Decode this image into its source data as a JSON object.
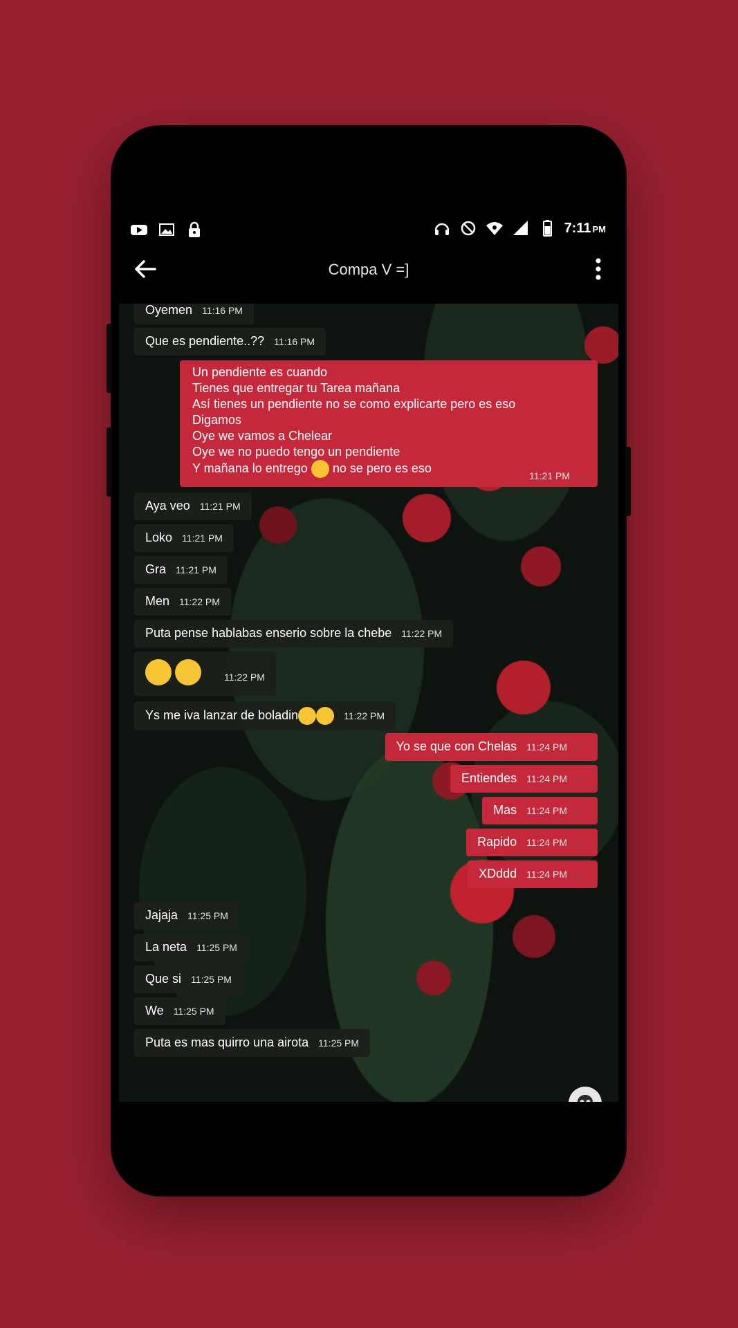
{
  "chat": {
    "title": "Compa V =]",
    "status_time": "7:11",
    "status_ampm": "PM",
    "messages": [
      {
        "dir": "in",
        "text": "Oyemen",
        "time": "11:16 PM"
      },
      {
        "dir": "in",
        "text": "Que es pendiente..??",
        "time": "11:16 PM"
      },
      {
        "dir": "out",
        "lines": [
          "Un pendiente es cuando",
          "Tienes que entregar tu Tarea mañana",
          "Así tienes un pendiente no se como explicarte pero es eso",
          "Digamos",
          "Oye we vamos a Chelear",
          "Oye we  no puedo tengo un pendiente",
          "Y mañana lo entrego",
          "no se pero es eso"
        ],
        "time": "11:21 PM"
      },
      {
        "dir": "in",
        "text": "Aya veo",
        "time": "11:21 PM"
      },
      {
        "dir": "in",
        "text": "Loko",
        "time": "11:21 PM"
      },
      {
        "dir": "in",
        "text": "Gra",
        "time": "11:21 PM"
      },
      {
        "dir": "in",
        "text": "Men",
        "time": "11:22 PM"
      },
      {
        "dir": "in",
        "text": "Puta pense hablabas enserio sobre la chebe",
        "time": "11:22 PM"
      },
      {
        "dir": "in",
        "text": "",
        "time": "11:22 PM"
      },
      {
        "dir": "in",
        "text": "Ys me iva lanzar de boladin",
        "time": "11:22 PM"
      },
      {
        "dir": "out",
        "text": "Yo se que con Chelas",
        "time": "11:24 PM"
      },
      {
        "dir": "out",
        "text": "Entiendes",
        "time": "11:24 PM"
      },
      {
        "dir": "out",
        "text": "Mas",
        "time": "11:24 PM"
      },
      {
        "dir": "out",
        "text": "Rapido",
        "time": "11:24 PM"
      },
      {
        "dir": "out",
        "text": "XDddd",
        "time": "11:24 PM"
      },
      {
        "dir": "in",
        "text": "Jajaja",
        "time": "11:25 PM"
      },
      {
        "dir": "in",
        "text": "La neta",
        "time": "11:25 PM"
      },
      {
        "dir": "in",
        "text": "Que si",
        "time": "11:25 PM"
      },
      {
        "dir": "in",
        "text": "We",
        "time": "11:25 PM"
      },
      {
        "dir": "in",
        "text": "Puta es mas quirro una airota",
        "time": "11:25 PM"
      }
    ]
  },
  "colors": {
    "background": "#97202f",
    "outgoing_bubble": "#c4283a",
    "incoming_bubble": "#1c201c",
    "accent": "#c4283a"
  },
  "icons": {
    "status_left": [
      "youtube-icon",
      "image-icon",
      "lock-icon"
    ],
    "status_right": [
      "headphones-icon",
      "do-not-disturb-icon",
      "wifi-icon",
      "signal-icon",
      "battery-icon"
    ],
    "toolbar": [
      "back-arrow-icon",
      "more-vert-icon"
    ],
    "input": [
      "emoji-icon",
      "camera-icon",
      "plus-icon",
      "mic-icon",
      "skull-icon"
    ]
  }
}
